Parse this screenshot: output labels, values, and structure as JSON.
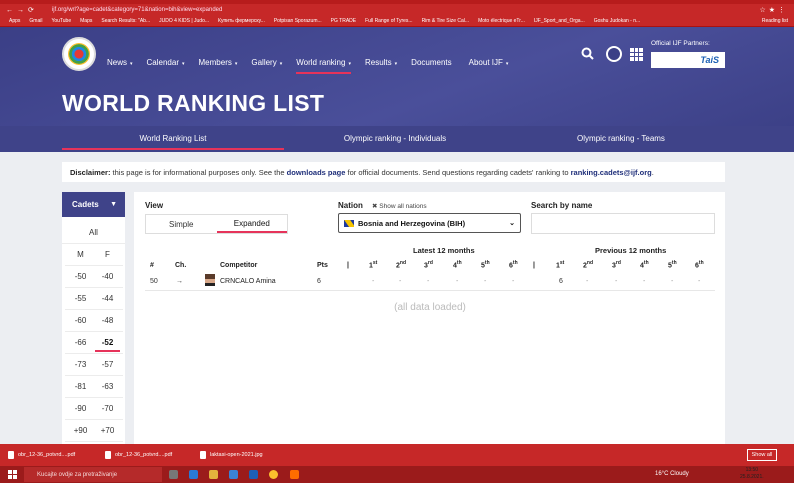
{
  "browser": {
    "url": "ijf.org/wrl?age=cadet&category=71&nation=bih&view=expanded",
    "bookmarks": [
      "Apps",
      "Gmail",
      "YouTube",
      "Maps",
      "Search Results: \"Ab...",
      "JUDO 4 KIDS | Judo...",
      "Купить фермерску...",
      "Potpisan Sporazum...",
      "PG TRADE",
      "Full Range of Tyres...",
      "Rim & Tire Size Cal...",
      "Moto électrique eTr...",
      "IJF_Sport_and_Orga...",
      "Goshu Judokan - n..."
    ],
    "reading_list": "Reading list"
  },
  "nav": {
    "items": [
      "News",
      "Calendar",
      "Members",
      "Gallery",
      "World ranking",
      "Results",
      "Documents",
      "About IJF"
    ],
    "carets": [
      "▾",
      "▾",
      "▾",
      "▾",
      "▾",
      "▾",
      "",
      "▾"
    ]
  },
  "partners_label": "Official IJF Partners:",
  "partner_name": "TaiS",
  "page_title": "WORLD RANKING LIST",
  "subtabs": [
    "World Ranking List",
    "Olympic ranking - Individuals",
    "Olympic ranking - Teams"
  ],
  "disclaimer": {
    "label": "Disclaimer:",
    "text1": " this page is for informational purposes only. See the ",
    "link1": "downloads page",
    "text2": " for official documents. Send questions regarding cadets' ranking to ",
    "link2": "ranking.cadets@ijf.org",
    "text3": "."
  },
  "sidebar": {
    "title": "Cadets",
    "all": "All",
    "col_m": "M",
    "col_f": "F",
    "m": [
      "-50",
      "-55",
      "-60",
      "-66",
      "-73",
      "-81",
      "-90",
      "+90"
    ],
    "f": [
      "-40",
      "-44",
      "-48",
      "-52",
      "-57",
      "-63",
      "-70",
      "+70"
    ],
    "selected_f_index": 3
  },
  "view": {
    "label": "View",
    "simple": "Simple",
    "expanded": "Expanded",
    "selected": "Expanded"
  },
  "nation": {
    "label": "Nation",
    "show_all": "✖ Show all nations",
    "selected": "Bosnia and Herzegovina (BIH)"
  },
  "search": {
    "label": "Search by name",
    "value": ""
  },
  "table": {
    "latest_header": "Latest 12 months",
    "previous_header": "Previous 12 months",
    "columns": {
      "rank": "#",
      "change": "Ch.",
      "competitor": "Competitor",
      "pts": "Pts",
      "sep": "|"
    },
    "ordinals": [
      [
        "1",
        "st"
      ],
      [
        "2",
        "nd"
      ],
      [
        "3",
        "rd"
      ],
      [
        "4",
        "th"
      ],
      [
        "5",
        "th"
      ],
      [
        "6",
        "th"
      ]
    ],
    "rows": [
      {
        "rank": "50",
        "change": "→",
        "name": "CRNCALO Amina",
        "pts": "6",
        "latest": [
          "-",
          "-",
          "-",
          "-",
          "-",
          "-"
        ],
        "previous": [
          "6",
          "-",
          "-",
          "-",
          "-",
          "-"
        ]
      }
    ],
    "footer": "(all data loaded)"
  },
  "downloads": [
    "obr_12-36_potvrd....pdf",
    "obr_12-36_potvrd....pdf",
    "laktasi-open-2021.jpg"
  ],
  "downloads_show_all": "Show all",
  "taskbar": {
    "search_placeholder": "Kucajte ovdje za pretraživanje",
    "weather": "16°C  Cloudy",
    "time": "13:50",
    "date": "25.8.2021."
  }
}
